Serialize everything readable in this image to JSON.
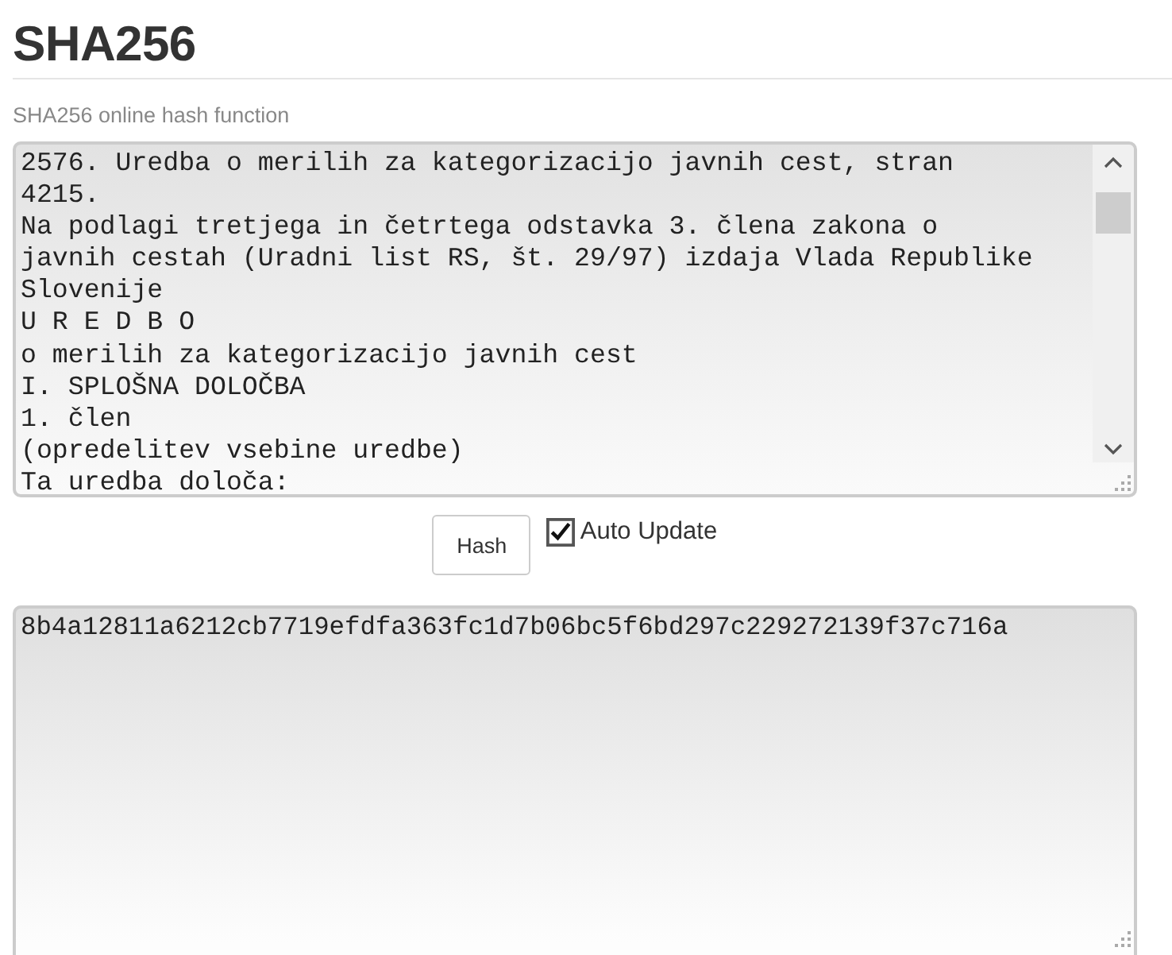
{
  "title": "SHA256",
  "subtitle": "SHA256 online hash function",
  "input": {
    "lines": [
      "2576. Uredba o merilih za kategorizacijo javnih cest, stran",
      "4215.",
      "Na podlagi tretjega in četrtega odstavka 3. člena zakona o",
      "javnih cestah (Uradni list RS, št. 29/97) izdaja Vlada Republike",
      "Slovenije",
      "U R E D B O",
      "o merilih za kategorizacijo javnih cest",
      "I. SPLOŠNA DOLOČBA",
      "1. člen",
      "(opredelitev vsebine uredbe)",
      "Ta uredba določa:"
    ]
  },
  "hash_button": "Hash",
  "auto_update": {
    "label": "Auto Update",
    "checked": true
  },
  "output": {
    "value": "8b4a12811a6212cb7719efdfa363fc1d7b06bc5f6bd297c229272139f37c716a"
  }
}
